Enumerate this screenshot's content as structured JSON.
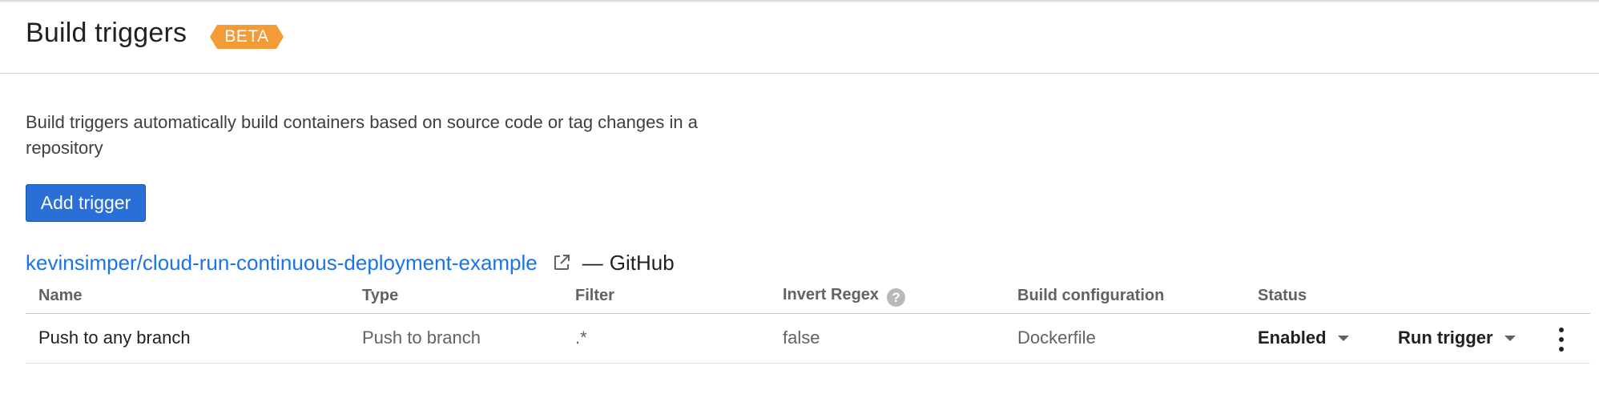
{
  "header": {
    "title": "Build triggers",
    "badge": "BETA"
  },
  "description": "Build triggers automatically build containers based on source code or tag changes in a repository",
  "add_trigger_label": "Add trigger",
  "repository": {
    "name": "kevinsimper/cloud-run-continuous-deployment-example",
    "separator": "—",
    "host": "GitHub"
  },
  "table": {
    "columns": {
      "name": "Name",
      "type": "Type",
      "filter": "Filter",
      "invert_regex": "Invert Regex",
      "build_configuration": "Build configuration",
      "status": "Status"
    },
    "rows": [
      {
        "name": "Push to any branch",
        "type": "Push to branch",
        "filter": ".*",
        "invert_regex": "false",
        "build_configuration": "Dockerfile",
        "status": "Enabled",
        "run_label": "Run trigger"
      }
    ]
  },
  "icons": {
    "external_link": "external-link-icon",
    "help": "help-icon",
    "dropdown": "caret-down-icon",
    "more": "more-vert-icon"
  },
  "colors": {
    "accent_blue": "#1a73e8",
    "button_blue": "#2a6fd6",
    "beta_orange": "#f29b37"
  }
}
